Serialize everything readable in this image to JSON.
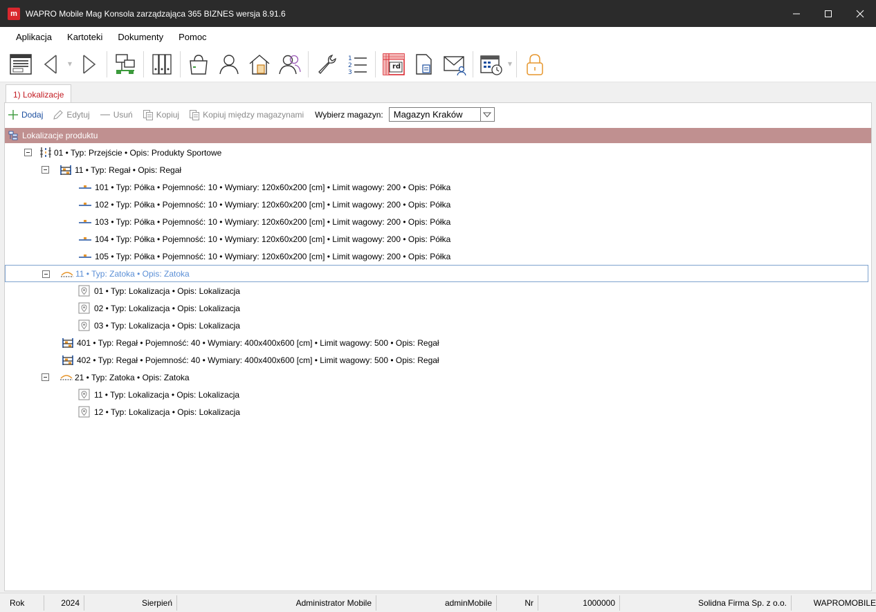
{
  "window": {
    "logo_letter": "m",
    "title": "WAPRO Mobile Mag Konsola zarządzająca 365 BIZNES wersja 8.91.6"
  },
  "menu": [
    "Aplikacja",
    "Kartoteki",
    "Dokumenty",
    "Pomoc"
  ],
  "toolbar": {
    "doc_button_label": "rd"
  },
  "tab": {
    "label": "1) Lokalizacje"
  },
  "actions": {
    "add": "Dodaj",
    "edit": "Edytuj",
    "delete": "Usuń",
    "copy": "Kopiuj",
    "copy_between": "Kopiuj między magazynami",
    "warehouse_label": "Wybierz magazyn:",
    "warehouse_value": "Magazyn Kraków"
  },
  "tree": {
    "header": "Lokalizacje produktu",
    "rows": [
      {
        "level": 0,
        "expander": true,
        "icon": "aisle-icon",
        "text": "01 • Typ: Przejście • Opis: Produkty Sportowe"
      },
      {
        "level": 1,
        "expander": true,
        "icon": "rack-icon",
        "text": "11 • Typ: Regał • Opis: Regał"
      },
      {
        "level": 2,
        "expander": false,
        "icon": "shelf-icon",
        "text": "101 • Typ: Półka • Pojemność: 10 • Wymiary: 120x60x200 [cm] • Limit wagowy: 200 • Opis: Półka"
      },
      {
        "level": 2,
        "expander": false,
        "icon": "shelf-icon",
        "text": "102 • Typ: Półka • Pojemność: 10 • Wymiary: 120x60x200 [cm] • Limit wagowy: 200 • Opis: Półka"
      },
      {
        "level": 2,
        "expander": false,
        "icon": "shelf-icon",
        "text": "103 • Typ: Półka • Pojemność: 10 • Wymiary: 120x60x200 [cm] • Limit wagowy: 200 • Opis: Półka"
      },
      {
        "level": 2,
        "expander": false,
        "icon": "shelf-icon",
        "text": "104 • Typ: Półka • Pojemność: 10 • Wymiary: 120x60x200 [cm] • Limit wagowy: 200 • Opis: Półka"
      },
      {
        "level": 2,
        "expander": false,
        "icon": "shelf-icon",
        "text": "105 • Typ: Półka • Pojemność: 10 • Wymiary: 120x60x200 [cm] • Limit wagowy: 200 • Opis: Półka"
      },
      {
        "level": 1,
        "expander": true,
        "icon": "bay-icon",
        "text": "11 • Typ: Zatoka • Opis: Zatoka",
        "selected": true
      },
      {
        "level": 2,
        "expander": false,
        "icon": "location-pin-icon",
        "text": "01 • Typ: Lokalizacja • Opis: Lokalizacja"
      },
      {
        "level": 2,
        "expander": false,
        "icon": "location-pin-icon",
        "text": "02 • Typ: Lokalizacja • Opis: Lokalizacja"
      },
      {
        "level": 2,
        "expander": false,
        "icon": "location-pin-icon",
        "text": "03 • Typ: Lokalizacja • Opis: Lokalizacja"
      },
      {
        "level": 1,
        "expander": false,
        "icon": "rack-icon",
        "text": "401 • Typ: Regał • Pojemność: 40 • Wymiary: 400x400x600 [cm] • Limit wagowy: 500 • Opis: Regał"
      },
      {
        "level": 1,
        "expander": false,
        "icon": "rack-icon",
        "text": "402 • Typ: Regał • Pojemność: 40 • Wymiary: 400x400x600 [cm] • Limit wagowy: 500 • Opis: Regał"
      },
      {
        "level": 1,
        "expander": true,
        "icon": "bay-icon",
        "text": "21 • Typ: Zatoka • Opis: Zatoka"
      },
      {
        "level": 2,
        "expander": false,
        "icon": "location-pin-icon",
        "text": "11 • Typ: Lokalizacja • Opis: Lokalizacja"
      },
      {
        "level": 2,
        "expander": false,
        "icon": "location-pin-icon",
        "text": "12 • Typ: Lokalizacja • Opis: Lokalizacja"
      }
    ]
  },
  "status": {
    "year_label": "Rok",
    "year": "2024",
    "month": "Sierpień",
    "user": "Administrator Mobile",
    "login": "adminMobile",
    "nr_label": "Nr",
    "nr": "1000000",
    "company": "Solidna Firma Sp. z o.o.",
    "app": "WAPROMOBILE"
  },
  "colors": {
    "titlebar": "#2b2b2b",
    "accent_red": "#d9272e",
    "tab_text": "#c2181f",
    "tree_header": "#c09090",
    "action_enabled": "#1b4e9e",
    "selected_text": "#5b8fd6"
  }
}
